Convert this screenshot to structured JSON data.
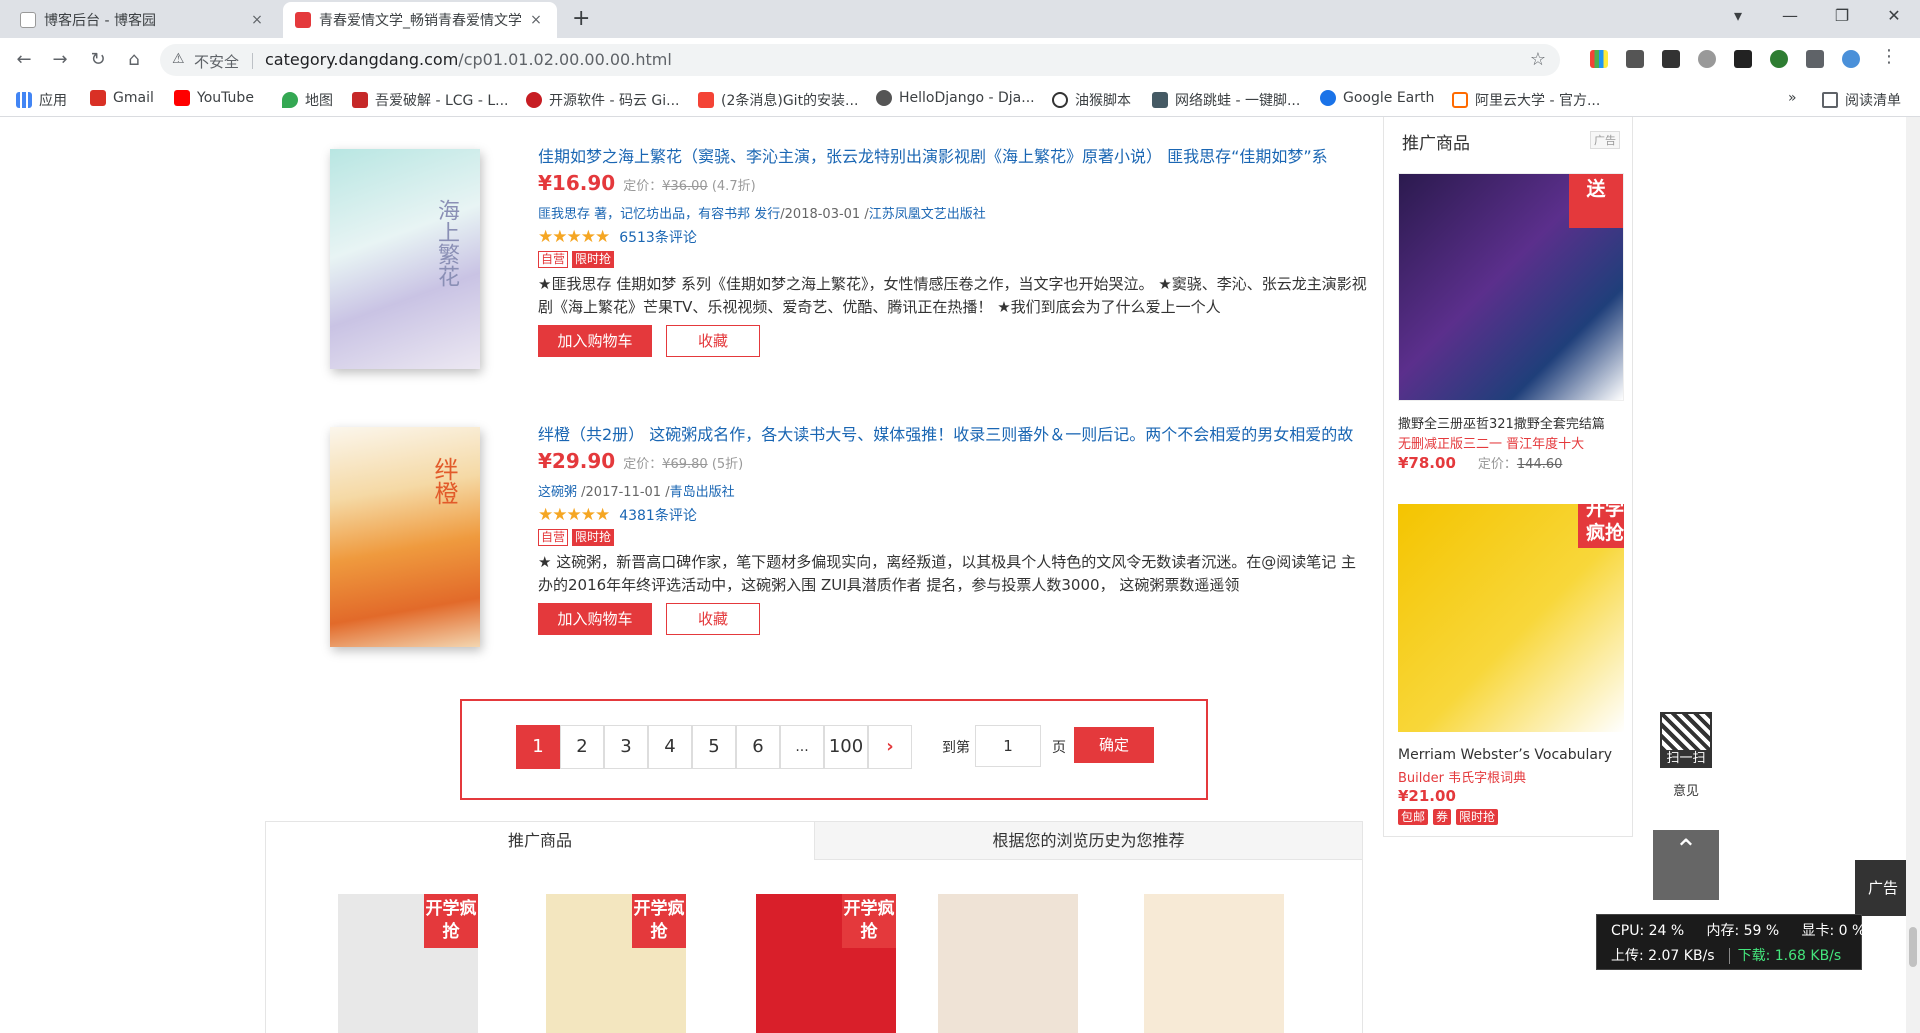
{
  "tabs": [
    {
      "title": "博客后台 - 博客园",
      "close": "×"
    },
    {
      "title": "青春爱情文学_畅销青春爱情文学",
      "close": "×"
    }
  ],
  "new_tab": "+",
  "window": {
    "profile": "▾",
    "minimize": "—",
    "maximize": "❐",
    "close": "✕"
  },
  "nav": {
    "back": "←",
    "forward": "→",
    "reload": "↻",
    "home": "⌂"
  },
  "omnibox": {
    "security_icon": "⚠",
    "security": "不安全",
    "host": "category.dangdang.com",
    "path": "/cp01.01.02.00.00.00.html",
    "star": "☆"
  },
  "bookmarks": [
    {
      "label": "应用",
      "color": "#ea4335"
    },
    {
      "label": "Gmail",
      "color": "#d93025"
    },
    {
      "label": "YouTube",
      "color": "#ff0000"
    },
    {
      "label": "地图",
      "color": "#34a853"
    },
    {
      "label": "吾爱破解 - LCG - L...",
      "color": "#c62828"
    },
    {
      "label": "开源软件 - 码云 Gi...",
      "color": "#c71d23"
    },
    {
      "label": "(2条消息)Git的安装...",
      "color": "#f44336"
    },
    {
      "label": "HelloDjango - Dja...",
      "color": "#555555"
    },
    {
      "label": "油猴脚本",
      "color": "#333333"
    },
    {
      "label": "网络跳蛙 - 一键脚...",
      "color": "#455a64"
    },
    {
      "label": "Google Earth",
      "color": "#1a73e8"
    },
    {
      "label": "阿里云大学 - 官方...",
      "color": "#ff6a00"
    }
  ],
  "bookmarks_more": "»",
  "reading_list": "阅读清单",
  "products": [
    {
      "title": "佳期如梦之海上繁花（窦骁、李沁主演，张云龙特别出演影视剧《海上繁花》原著小说） 匪我思存“佳期如梦”系",
      "price": "¥16.90",
      "list_label": "定价：",
      "list_price": "¥36.00",
      "discount": "(4.7折)",
      "author": "匪我思存 著，记忆坊出品，有容书邦 发行",
      "date": "/2018-03-01 /",
      "publisher": "江苏凤凰文艺出版社",
      "stars": "★★★★★",
      "reviews": "6513条评论",
      "badge1": "自营",
      "badge2": "限时抢",
      "desc": "★匪我思存 佳期如梦 系列《佳期如梦之海上繁花》，女性情感压卷之作，当文字也开始哭泣。 ★窦骁、李沁、张云龙主演影视剧《海上繁花》芒果TV、乐视视频、爱奇艺、优酷、腾讯正在热播！ ★我们到底会为了什么爱上一个人",
      "cart": "加入购物车",
      "fav": "收藏",
      "cover_text": "海上繁花"
    },
    {
      "title": "绊橙（共2册） 这碗粥成名作，各大读书大号、媒体强推！收录三则番外＆一则后记。两个不会相爱的男女相爱的故",
      "price": "¥29.90",
      "list_label": "定价：",
      "list_price": "¥69.80",
      "discount": "(5折)",
      "author": "这碗粥",
      "date": " /2017-11-01 /",
      "publisher": "青岛出版社",
      "stars": "★★★★★",
      "reviews": "4381条评论",
      "badge1": "自营",
      "badge2": "限时抢",
      "desc": "★ 这碗粥，新晋高口碑作家，笔下题材多偏现实向，离经叛道，以其极具个人特色的文风令无数读者沉迷。在@阅读笔记 主办的2016年年终评选活动中，这碗粥入围 ZUI具潜质作者 提名，参与投票人数3000， 这碗粥票数遥遥领",
      "cart": "加入购物车",
      "fav": "收藏",
      "cover_text": "绊橙"
    }
  ],
  "pagination": {
    "pages": [
      "1",
      "2",
      "3",
      "4",
      "5",
      "6",
      "...",
      "100"
    ],
    "current": "1",
    "next": "›",
    "goto_label": "到第",
    "input_value": "1",
    "unit": "页",
    "confirm": "确定"
  },
  "recommend": {
    "tab_active": "推广商品",
    "tab_other": "根据您的浏览历史为您推荐",
    "items": [
      {
        "tag": "开学疯抢",
        "color": "#e8e8e8"
      },
      {
        "tag": "开学疯抢",
        "color": "#f3e6bf"
      },
      {
        "tag": "开学疯抢",
        "color": "#d91f2a"
      },
      {
        "tag": "",
        "color": "#efe3d6"
      },
      {
        "tag": "",
        "color": "#f7ead6"
      }
    ]
  },
  "ad_column": {
    "title": "推广商品",
    "label": "广告",
    "items": [
      {
        "name": "撒野全三册巫哲321撒野全套完结篇",
        "sub": "无删减正版三二一 晋江年度十大",
        "price": "¥78.00",
        "list_label": "定价：",
        "list_price": "144.60",
        "overlay": "送"
      },
      {
        "name": "Merriam Webster’s Vocabulary",
        "sub": "Builder 韦氏字根词典",
        "price": "¥21.00",
        "overlay": "开学疯抢",
        "badges": [
          "包邮",
          "券",
          "限时抢"
        ]
      }
    ]
  },
  "floats": {
    "qr_label": "扫一扫",
    "feedback": "意见",
    "scroll_top": "⌃",
    "ad": "广告"
  },
  "sysmon": {
    "cpu": "CPU: 24 %",
    "mem": "内存: 59 %",
    "gpu": "显卡: 0 %",
    "up": "上传: 2.07 KB/s",
    "down": "下载: 1.68 KB/s"
  }
}
